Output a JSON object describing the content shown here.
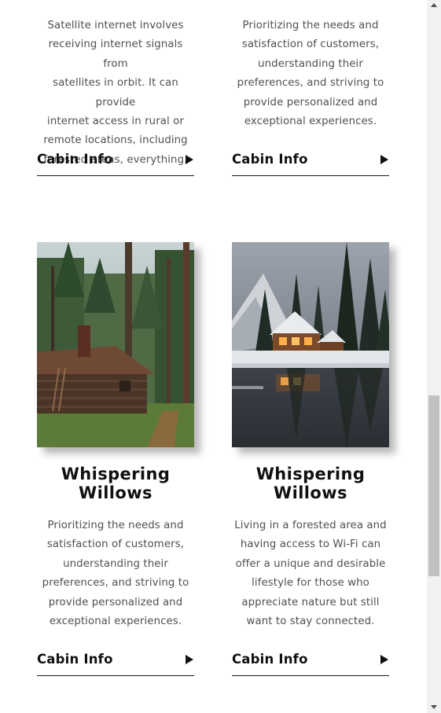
{
  "cards_top": [
    {
      "description": [
        "Satellite internet involves",
        "receiving internet signals from",
        "satellites in orbit. It can provide",
        "internet access in rural or",
        "remote locations, including",
        "forested areas, everything."
      ],
      "link_label": "Cabin Info"
    },
    {
      "description": [
        "Prioritizing the needs and",
        "satisfaction of customers,",
        "understanding their",
        "preferences, and striving to",
        "provide personalized and",
        "exceptional experiences."
      ],
      "link_label": "Cabin Info"
    }
  ],
  "cards_bottom": [
    {
      "image_icon": "forest-cabin-photo",
      "title_line1": "Whispering",
      "title_line2": "Willows",
      "description": [
        "Prioritizing the needs and",
        "satisfaction of customers,",
        "understanding their",
        "preferences, and striving to",
        "provide personalized and",
        "exceptional experiences."
      ],
      "link_label": "Cabin Info"
    },
    {
      "image_icon": "snowy-lake-cabin-photo",
      "title_line1": "Whispering",
      "title_line2": "Willows",
      "description": [
        "Living in a forested area and",
        "having access to Wi-Fi can",
        "offer a unique and desirable",
        "lifestyle for those who",
        "appreciate nature but still",
        "want to stay connected."
      ],
      "link_label": "Cabin Info"
    }
  ],
  "colors": {
    "text": "#111111",
    "body_text": "#505050",
    "scrollbar_track": "#f1f1f1",
    "scrollbar_thumb": "#c1c1c1"
  }
}
